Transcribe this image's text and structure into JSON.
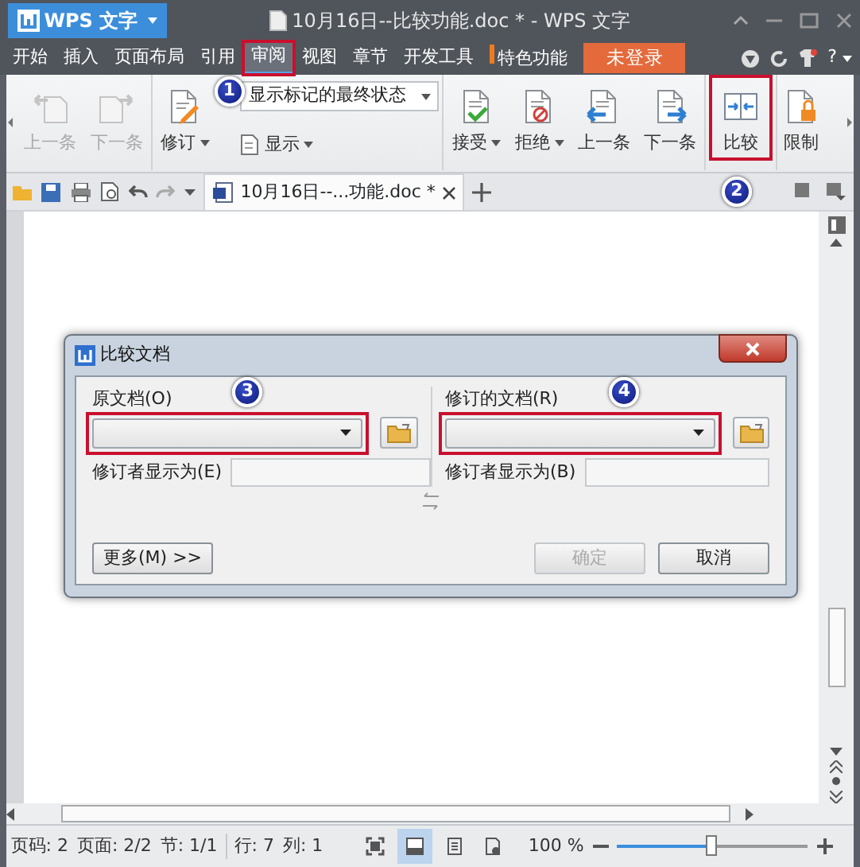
{
  "app_button": {
    "label": "WPS 文字"
  },
  "window": {
    "title": "10月16日--比较功能.doc * - WPS 文字"
  },
  "menu": [
    {
      "label": "开始",
      "selected": false,
      "highlighted": false
    },
    {
      "label": "插入",
      "selected": false,
      "highlighted": false
    },
    {
      "label": "页面布局",
      "selected": false,
      "highlighted": false
    },
    {
      "label": "引用",
      "selected": false,
      "highlighted": false
    },
    {
      "label": "审阅",
      "selected": true,
      "highlighted": true
    },
    {
      "label": "视图",
      "selected": false,
      "highlighted": false
    },
    {
      "label": "章节",
      "selected": false,
      "highlighted": false
    },
    {
      "label": "开发工具",
      "selected": false,
      "highlighted": false
    },
    {
      "label": "特色功能",
      "selected": false,
      "highlighted": false
    }
  ],
  "login_button": {
    "label": "未登录"
  },
  "help_label": "?",
  "ribbon_groups": [
    {
      "items": [
        {
          "kind": "large",
          "label": "上一条",
          "disabled": true,
          "dropdown": false,
          "highlighted": false
        },
        {
          "kind": "large",
          "label": "下一条",
          "disabled": true,
          "dropdown": false,
          "highlighted": false
        }
      ]
    },
    {
      "items": [
        {
          "kind": "large",
          "label": "修订",
          "disabled": false,
          "dropdown": true,
          "highlighted": false
        },
        {
          "kind": "select",
          "value": "显示标记的最终状态"
        },
        {
          "kind": "small",
          "label": "显示",
          "disabled": false,
          "dropdown": true,
          "highlighted": false
        }
      ]
    },
    {
      "items": [
        {
          "kind": "large",
          "label": "接受",
          "disabled": false,
          "dropdown": true,
          "highlighted": false
        },
        {
          "kind": "large",
          "label": "拒绝",
          "disabled": false,
          "dropdown": true,
          "highlighted": false
        },
        {
          "kind": "large",
          "label": "上一条",
          "disabled": false,
          "dropdown": false,
          "highlighted": false
        },
        {
          "kind": "large",
          "label": "下一条",
          "disabled": false,
          "dropdown": false,
          "highlighted": false
        }
      ]
    },
    {
      "items": [
        {
          "kind": "large",
          "label": "比较",
          "disabled": false,
          "dropdown": false,
          "highlighted": true
        }
      ]
    },
    {
      "items": [
        {
          "kind": "large",
          "label": "限制",
          "disabled": false,
          "dropdown": false,
          "highlighted": false
        }
      ]
    }
  ],
  "tabs": [
    {
      "label": "10月16日--...功能.doc *",
      "selected": true
    }
  ],
  "dialog": {
    "title": "比较文档",
    "original": {
      "label": "原文档(O)",
      "author_label": "修订者显示为(E)",
      "highlighted": true
    },
    "revised": {
      "label": "修订的文档(R)",
      "author_label": "修订者显示为(B)",
      "highlighted": true
    },
    "buttons": [
      {
        "label": "更多(M) >>",
        "disabled": false
      },
      {
        "label": "确定",
        "disabled": true
      },
      {
        "label": "取消",
        "disabled": false
      }
    ]
  },
  "callouts": [
    {
      "number": "1"
    },
    {
      "number": "2"
    },
    {
      "number": "3"
    },
    {
      "number": "4"
    }
  ],
  "status_bar": {
    "items": [
      "页码: 2",
      "页面: 2/2",
      "节: 1/1",
      "行: 7",
      "列: 1"
    ],
    "view_modes": [
      {
        "selected": false
      },
      {
        "selected": true
      },
      {
        "selected": false
      },
      {
        "selected": false
      }
    ],
    "zoom": {
      "reading": "100 %",
      "level": 0.5
    }
  }
}
